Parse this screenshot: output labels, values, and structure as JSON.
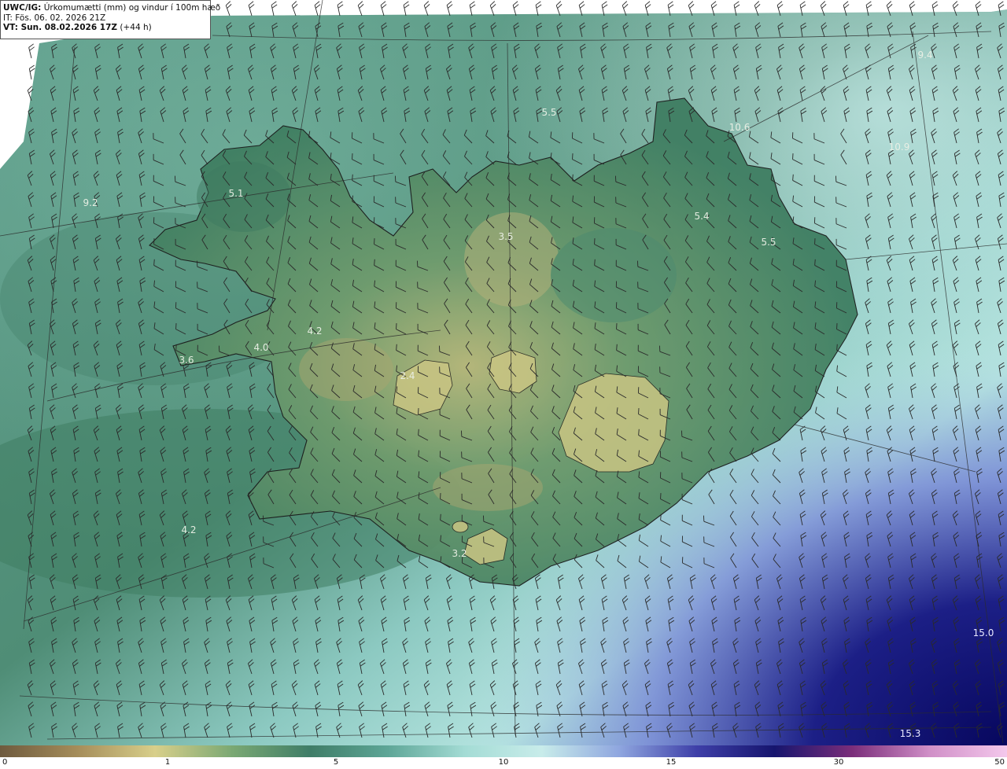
{
  "header": {
    "model_prefix": "UWC/IG:",
    "title": " Úrkomumætti (mm) og vindur í 100m hæð",
    "issue_time": "IT: Fös. 06. 02. 2026 21Z",
    "valid_time_bold": "VT: Sun. 08.02.2026 17Z",
    "valid_time_lead": " (+44 h)"
  },
  "point_values": [
    {
      "id": "a",
      "text": "9.2"
    },
    {
      "id": "b",
      "text": "5.1"
    },
    {
      "id": "c",
      "text": "5.5"
    },
    {
      "id": "d",
      "text": "10.6"
    },
    {
      "id": "e",
      "text": "10.9"
    },
    {
      "id": "f",
      "text": "9.4"
    },
    {
      "id": "g",
      "text": "5.4"
    },
    {
      "id": "h",
      "text": "5.5"
    },
    {
      "id": "i",
      "text": "3.5"
    },
    {
      "id": "j",
      "text": "4.2"
    },
    {
      "id": "k",
      "text": "4.0"
    },
    {
      "id": "l",
      "text": "3.6"
    },
    {
      "id": "m",
      "text": "2.4"
    },
    {
      "id": "n",
      "text": "4.2"
    },
    {
      "id": "o",
      "text": "3.2"
    },
    {
      "id": "p",
      "text": "15.0"
    },
    {
      "id": "q",
      "text": "15.3"
    }
  ],
  "colorbar": {
    "ticks": [
      "0",
      "1",
      "5",
      "10",
      "15",
      "30",
      "50"
    ],
    "colors": [
      "#6e5a3e",
      "#a58d5a",
      "#d8cf8a",
      "#7aa873",
      "#3f7d67",
      "#5ea697",
      "#a4dcd5",
      "#c8ecea",
      "#8fa6df",
      "#3e3fa8",
      "#16156e",
      "#7a2d7a",
      "#d08fc7",
      "#f4c8ec"
    ]
  },
  "colors": {
    "land_outline": "#1a1a1a",
    "graticule": "#2b2b2b",
    "barb": "#2a2a2a"
  }
}
